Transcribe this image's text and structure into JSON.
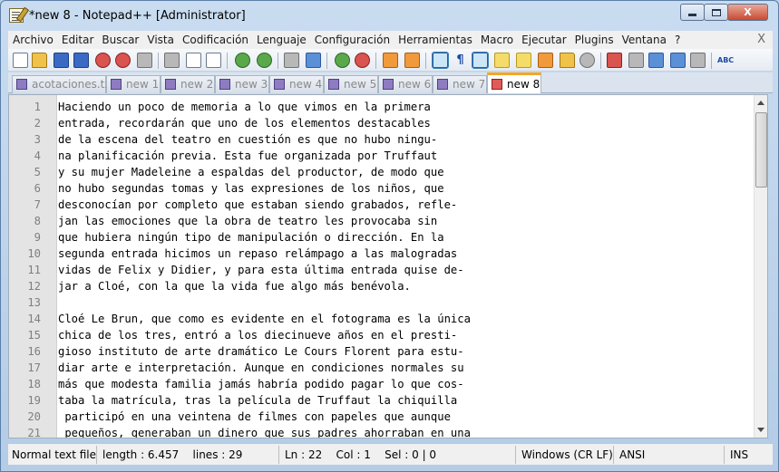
{
  "window": {
    "title": "*new 8 - Notepad++ [Administrator]",
    "close_glyph": "X"
  },
  "menu": {
    "items": [
      "Archivo",
      "Editar",
      "Buscar",
      "Vista",
      "Codificación",
      "Lenguaje",
      "Configuración",
      "Herramientas",
      "Macro",
      "Ejecutar",
      "Plugins",
      "Ventana",
      "?"
    ],
    "close": "X"
  },
  "toolbar": {
    "icons": [
      "new-file-icon",
      "open-file-icon",
      "save-icon",
      "save-all-icon",
      "close-icon",
      "close-all-icon",
      "print-icon",
      "cut-icon",
      "copy-icon",
      "paste-icon",
      "undo-icon",
      "redo-icon",
      "find-icon",
      "replace-icon",
      "zoom-in-icon",
      "zoom-out-icon",
      "sync-vertical-icon",
      "sync-horizontal-icon",
      "word-wrap-icon",
      "show-all-chars-icon",
      "indent-guide-icon",
      "user-language-icon",
      "doc-map-icon",
      "function-list-icon",
      "folder-workspace-icon",
      "record-macro-icon",
      "stop-macro-icon",
      "play-macro-icon",
      "run-macro-multiple-icon",
      "save-macro-icon",
      "spell-check-icon"
    ],
    "spell_glyph": "ABC"
  },
  "tabs": [
    {
      "label": "acotaciones.txt",
      "active": false
    },
    {
      "label": "new 1",
      "active": false
    },
    {
      "label": "new 2",
      "active": false
    },
    {
      "label": "new 3",
      "active": false
    },
    {
      "label": "new 4",
      "active": false
    },
    {
      "label": "new 5",
      "active": false
    },
    {
      "label": "new 6",
      "active": false
    },
    {
      "label": "new 7",
      "active": false
    },
    {
      "label": "new 8",
      "active": true
    }
  ],
  "editor": {
    "lines": [
      {
        "n": "1",
        "text": "Haciendo un poco de memoria a lo que vimos en la primera"
      },
      {
        "n": "2",
        "text": "entrada, recordarán que uno de los elementos destacables"
      },
      {
        "n": "3",
        "text": "de la escena del teatro en cuestión es que no hubo ningu-"
      },
      {
        "n": "4",
        "text": "na planificación previa. Esta fue organizada por Truffaut"
      },
      {
        "n": "5",
        "text": "y su mujer Madeleine a espaldas del productor, de modo que"
      },
      {
        "n": "6",
        "text": "no hubo segundas tomas y las expresiones de los niños, que"
      },
      {
        "n": "7",
        "text": "desconocían por completo que estaban siendo grabados, refle-"
      },
      {
        "n": "8",
        "text": "jan las emociones que la obra de teatro les provocaba sin"
      },
      {
        "n": "9",
        "text": "que hubiera ningún tipo de manipulación o dirección. En la"
      },
      {
        "n": "10",
        "text": "segunda entrada hicimos un repaso relámpago a las malogradas"
      },
      {
        "n": "11",
        "text": "vidas de Felix y Didier, y para esta última entrada quise de-"
      },
      {
        "n": "12",
        "text": "jar a Cloé, con la que la vida fue algo más benévola."
      },
      {
        "n": "13",
        "text": ""
      },
      {
        "n": "14",
        "text": "Cloé Le Brun, que como es evidente en el fotograma es la única"
      },
      {
        "n": "15",
        "text": "chica de los tres, entró a los diecinueve años en el presti-"
      },
      {
        "n": "16",
        "text": "gioso instituto de arte dramático Le Cours Florent para estu-"
      },
      {
        "n": "17",
        "text": "diar arte e interpretación. Aunque en condiciones normales su"
      },
      {
        "n": "18",
        "text": "más que modesta familia jamás habría podido pagar lo que cos-"
      },
      {
        "n": "19",
        "text": "taba la matrícula, tras la película de Truffaut la chiquilla"
      },
      {
        "n": "20",
        "text": " participó en una veintena de filmes con papeles que aunque"
      },
      {
        "n": "21",
        "text": " pequeños, generaban un dinero que sus padres ahorraban en una"
      }
    ]
  },
  "status": {
    "type": "Normal text file",
    "length": "length : 6.457    lines : 29",
    "position": "Ln : 22    Col : 1    Sel : 0 | 0",
    "eol": "Windows (CR LF)",
    "encoding": "ANSI",
    "mode": "INS"
  }
}
